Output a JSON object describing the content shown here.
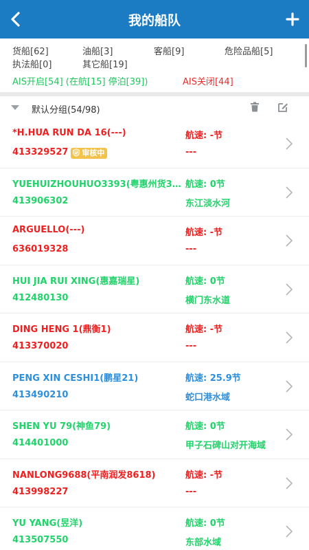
{
  "header": {
    "title": "我的船队",
    "back_icon": "chevron-left-icon",
    "add_icon": "plus-icon"
  },
  "stats": {
    "cargo": "货船[62]",
    "oil": "油船[3]",
    "passenger": "客船[9]",
    "dangerous": "危险品船[5]",
    "law": "执法船[0]",
    "other": "其它船[19]",
    "ais_on": "AIS开启[54] (在航[15] 停泊[39])",
    "ais_off": "AIS关闭[44]"
  },
  "group": {
    "name": "默认分组(54/98)"
  },
  "ships": [
    {
      "name": "*H.HUA RUN DA 16(---)",
      "mmsi": "413329527",
      "badge": "审核中",
      "speed": "航速: -节",
      "area": "---",
      "color": "red"
    },
    {
      "name": "YUEHUIZHOUHUO3393(粤惠州货3393)",
      "mmsi": "413906302",
      "badge": "",
      "speed": "航速: 0节",
      "area": "东江淡水河",
      "color": "green"
    },
    {
      "name": "ARGUELLO(---)",
      "mmsi": "636019328",
      "badge": "",
      "speed": "航速: -节",
      "area": "---",
      "color": "red"
    },
    {
      "name": "HUI JIA RUI XING(惠嘉瑞星)",
      "mmsi": "412480130",
      "badge": "",
      "speed": "航速: 0节",
      "area": "横门东水道",
      "color": "green"
    },
    {
      "name": "DING HENG 1(鼎衡1)",
      "mmsi": "413370020",
      "badge": "",
      "speed": "航速: -节",
      "area": "---",
      "color": "red"
    },
    {
      "name": "PENG XIN CESHI1(鹏星21)",
      "mmsi": "413490210",
      "badge": "",
      "speed": "航速: 25.9节",
      "area": "蛇口港水域",
      "color": "blue"
    },
    {
      "name": "SHEN YU 79(神鱼79)",
      "mmsi": "414401000",
      "badge": "",
      "speed": "航速: 0节",
      "area": "甲子石碑山对开海域",
      "color": "green"
    },
    {
      "name": "NANLONG9688(平南润发8618)",
      "mmsi": "413998227",
      "badge": "",
      "speed": "航速: -节",
      "area": "---",
      "color": "red"
    },
    {
      "name": "YU YANG(昱洋)",
      "mmsi": "413507550",
      "badge": "",
      "speed": "航速: 0节",
      "area": "东部水域",
      "color": "green"
    }
  ],
  "colors": {
    "header": "#1b7cc4",
    "red": "#ef2020",
    "green": "#22d36b",
    "blue": "#2e8fdc"
  }
}
